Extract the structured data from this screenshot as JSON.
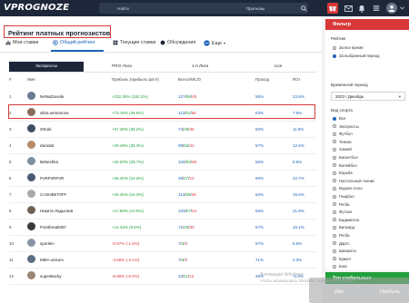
{
  "header": {
    "logo": "VPROGNOZE",
    "search_placeholder": "Найти",
    "search_category": "Прогнозы"
  },
  "page": {
    "title": "Рейтинг платных прогнозистов"
  },
  "tabs": [
    {
      "label": "Мои ставки"
    },
    {
      "label": "Общий рейтинг"
    },
    {
      "label": "Текущие ставки"
    },
    {
      "label": "Обсуждения"
    },
    {
      "label": "Еще"
    }
  ],
  "subtabs": [
    {
      "label": "Экспресcы"
    },
    {
      "label": "PRO Лига"
    },
    {
      "label": "1-я Лига"
    },
    {
      "label": "Live"
    }
  ],
  "table": {
    "headers": {
      "num": "#",
      "name": "Имя",
      "profit": "Прибыль (прибыль флэт)",
      "record": "Всего/W/L/D",
      "pass": "Проход",
      "roi": "ROI"
    },
    "rows": [
      {
        "n": "1",
        "name": "NeNaZavode",
        "profit": "+232.35% (152.2%)",
        "total": "127",
        "w": "99",
        "l": "49",
        "pct": "55%",
        "roi": "23.6%"
      },
      {
        "n": "2",
        "name": "alina.semenova",
        "profit": "+73.15% (46.8%)",
        "total": "113",
        "w": "61",
        "l": "56",
        "pct": "63%",
        "roi": "7.6%"
      },
      {
        "n": "3",
        "name": "20nah",
        "profit": "+57.30% (35.2%)",
        "total": "74",
        "w": "38",
        "l": "36",
        "pct": "60%",
        "roi": "11.8%"
      },
      {
        "n": "4",
        "name": "daradat",
        "profit": "+49.49% (35.3%)",
        "total": "99",
        "w": "56",
        "l": "42",
        "pct": "57%",
        "roi": "12.6%"
      },
      {
        "n": "5",
        "name": "Bebeshka",
        "profit": "+40.00% (26.7%)",
        "total": "104",
        "w": "54",
        "l": "49",
        "pct": "55%",
        "roi": "8.6%"
      },
      {
        "n": "6",
        "name": "PoRPoRPoR",
        "profit": "+36.40% (24.3%)",
        "total": "39",
        "w": "27",
        "l": "12",
        "pct": "69%",
        "roi": "22.7%"
      },
      {
        "n": "7",
        "name": "CASHBET0FF",
        "profit": "+26.46% (15.3%)",
        "total": "114",
        "w": "69",
        "l": "45",
        "pct": "54%",
        "roi": "15.6%"
      },
      {
        "n": "8",
        "name": "Никита Ладыгаев",
        "profit": "+17.80% (10.5%)",
        "total": "103",
        "w": "57",
        "l": "44",
        "pct": "56%",
        "roi": "21.9%"
      },
      {
        "n": "9",
        "name": "Pointbreak087",
        "profit": "+14.33% (9.5%)",
        "total": "71",
        "w": "40",
        "l": "30",
        "pct": "57%",
        "roi": "15.1%"
      },
      {
        "n": "10",
        "name": "sporlein",
        "profit": "-0.97% (-1.6%)",
        "total": "7",
        "w": "4",
        "l": "3",
        "pct": "57%",
        "roi": "6.5%"
      },
      {
        "n": "11",
        "name": "MMA unisom",
        "profit": "-4.66% (-3.1%)",
        "total": "7",
        "w": "4",
        "l": "3",
        "pct": "71%",
        "roi": "2.3%"
      },
      {
        "n": "12",
        "name": "superBacky",
        "profit": "-6.95% (-5.0%)",
        "total": "23",
        "w": "11",
        "l": "12",
        "pct": "48%",
        "roi": "-0.3%"
      }
    ]
  },
  "sidebar": {
    "filter_title": "Фильтр",
    "rating_label": "Рейтинг",
    "rating_options": [
      "За все время",
      "За выбранный период"
    ],
    "period_label": "Временной период",
    "period_value": "2023 / Декабрь",
    "sport_label": "Вид спорта",
    "sports": [
      "Все",
      "Экспрессы",
      "Футбол",
      "Теннис",
      "Хоккей",
      "Баскетбол",
      "Волейбол",
      "Борьба",
      "Настольный теннис",
      "Водное поло",
      "Гандбол",
      "Регби",
      "Футзал",
      "Бадминтон",
      "Бильярд",
      "Регби",
      "Дартс",
      "Шахматы",
      "Крикет",
      "Бокс"
    ],
    "top_title": "Топ стабильных"
  },
  "overlay": {
    "watermark": "Активация Windows",
    "watermark_sub": "Чтобы активировать Windows, перейдите в раздел",
    "bottom_left": "Имя",
    "bottom_right": "Прибыль"
  },
  "colors": {
    "topbar": "#1d2739",
    "accent_red": "#d9383a",
    "accent_blue": "#1e63b8",
    "positive": "#23a03d",
    "negative": "#d9383a"
  }
}
